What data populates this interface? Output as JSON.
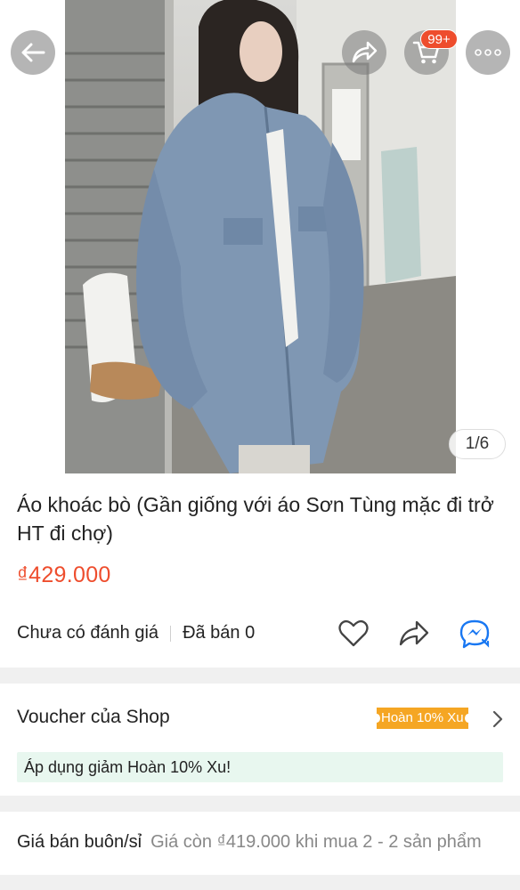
{
  "header": {
    "cart_badge": "99+",
    "image_counter": "1/6",
    "icons": [
      "back-arrow-icon",
      "share-icon",
      "cart-icon",
      "more-icon"
    ]
  },
  "product": {
    "title": "Áo khoác bò (Gần giống với áo Sơn Tùng mặc đi trở HT đi chợ)",
    "price": "₫429.000",
    "rating_text": "Chưa có đánh giá",
    "sold_text": "Đã bán 0"
  },
  "voucher": {
    "label": "Voucher của Shop",
    "tag": "Hoàn 10% Xu",
    "apply_text": "Áp dụng giảm Hoàn 10% Xu!"
  },
  "wholesale": {
    "label": "Giá bán buôn/sỉ",
    "description": "Giá còn ₫419.000 khi mua 2 - 2 sản phẩm"
  },
  "colors": {
    "accent": "#ee4d2d",
    "voucher_tag": "#f5a623",
    "apply_bg": "#e8f7ef",
    "messenger": "#1877f2"
  }
}
